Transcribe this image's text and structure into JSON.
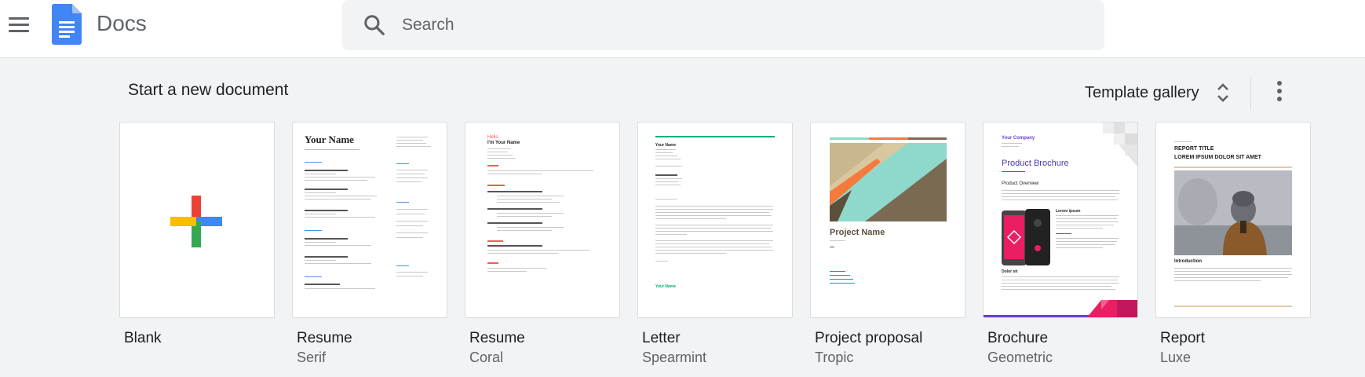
{
  "header": {
    "app_title": "Docs",
    "search": {
      "placeholder": "Search",
      "value": ""
    }
  },
  "section": {
    "title": "Start a new document",
    "gallery_label": "Template gallery"
  },
  "templates": [
    {
      "name": "Blank",
      "sub": ""
    },
    {
      "name": "Resume",
      "sub": "Serif"
    },
    {
      "name": "Resume",
      "sub": "Coral"
    },
    {
      "name": "Letter",
      "sub": "Spearmint"
    },
    {
      "name": "Project proposal",
      "sub": "Tropic"
    },
    {
      "name": "Brochure",
      "sub": "Geometric"
    },
    {
      "name": "Report",
      "sub": "Luxe"
    }
  ],
  "thumbs": {
    "serif_name": "Your Name",
    "coral_hello": "Hello",
    "coral_name": "I'm Your Name",
    "letter_name": "Your Name",
    "letter_footer": "Your Name",
    "proposal_title": "Project Name",
    "brochure_company": "Your Company",
    "brochure_title": "Product Brochure",
    "brochure_overview": "Product Overview",
    "brochure_lorem": "Lorem ipsum",
    "brochure_dolor": "Dolor sit",
    "report_title": "REPORT TITLE",
    "report_subtitle": "LOREM IPSUM DOLOR SIT AMET",
    "report_intro": "Introduction"
  },
  "colors": {
    "docs_blue": "#4285f4",
    "plus_red": "#ea4335",
    "plus_blue": "#4285f4",
    "plus_yellow": "#fbbc04",
    "plus_green": "#34a853",
    "coral": "#f25c54",
    "spearmint": "#00b07a",
    "tropic_teal": "#8ed9cc",
    "tropic_brown": "#7a6a52",
    "tropic_orange": "#f47b3b",
    "geometric_purple": "#6a3ecf",
    "geometric_pink": "#e91e63"
  },
  "icons": [
    "menu-icon",
    "docs-logo-icon",
    "search-icon",
    "unfold-icon",
    "more-vert-icon",
    "plus-icon"
  ]
}
